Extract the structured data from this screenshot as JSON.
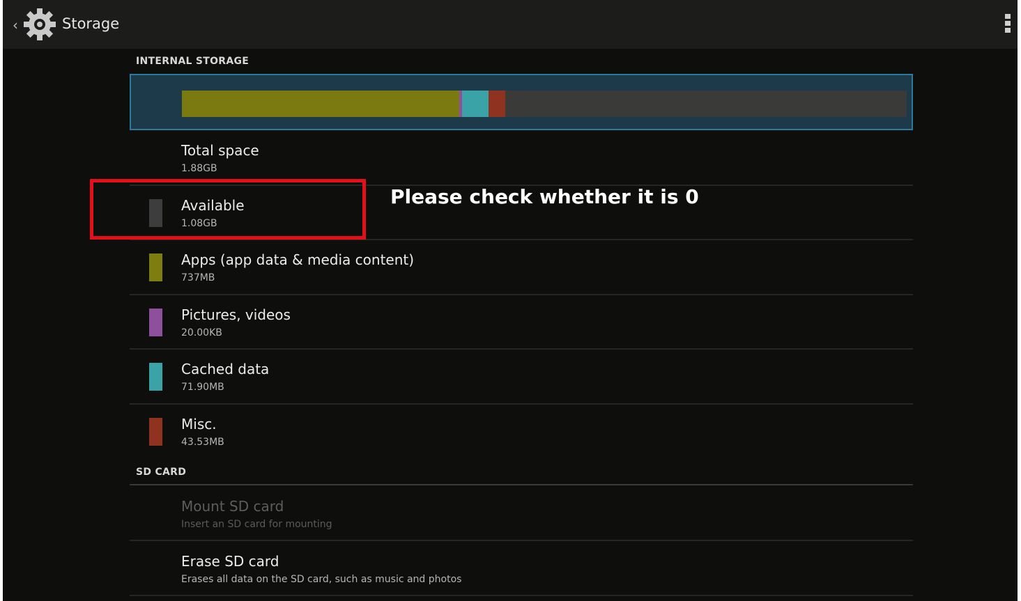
{
  "action_bar": {
    "back_glyph": "‹",
    "app_icon": "gear-icon",
    "title": "Storage",
    "overflow_icon": "overflow-menu-icon"
  },
  "internal_storage": {
    "header": "INTERNAL STORAGE",
    "usage_bar": [
      {
        "name": "Apps",
        "fraction": 0.383,
        "color": "#7a7a10"
      },
      {
        "name": "Pictures, videos",
        "fraction": 0.004,
        "color": "#8e4f9c"
      },
      {
        "name": "Cached data",
        "fraction": 0.036,
        "color": "#3aa3a8"
      },
      {
        "name": "Misc.",
        "fraction": 0.023,
        "color": "#8f3320"
      },
      {
        "name": "Available",
        "fraction": 0.554,
        "color": "#3a3a39"
      }
    ],
    "rows": [
      {
        "title": "Total space",
        "value": "1.88GB",
        "swatch": null
      },
      {
        "title": "Available",
        "value": "1.08GB",
        "swatch": "#3d3d3d"
      },
      {
        "title": "Apps (app data & media content)",
        "value": "737MB",
        "swatch": "#7d7e0f"
      },
      {
        "title": "Pictures, videos",
        "value": "20.00KB",
        "swatch": "#8e4f9c"
      },
      {
        "title": "Cached data",
        "value": "71.90MB",
        "swatch": "#3aa3a8"
      },
      {
        "title": "Misc.",
        "value": "43.53MB",
        "swatch": "#8f3320"
      }
    ]
  },
  "sd_card": {
    "header": "SD CARD",
    "rows": [
      {
        "title": "Mount SD card",
        "value": "Insert an SD card for mounting",
        "enabled": false
      },
      {
        "title": "Erase SD card",
        "value": "Erases all data on the SD card, such as music and photos",
        "enabled": true
      }
    ]
  },
  "annotation": {
    "text": "Please check whether it is 0",
    "highlight_color": "#e3101c"
  }
}
